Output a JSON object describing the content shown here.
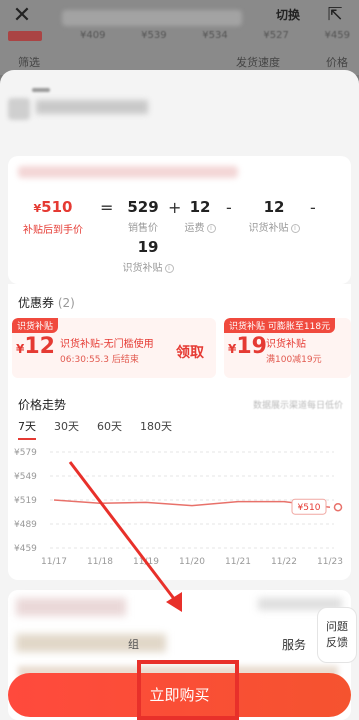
{
  "background": {
    "switch_label": "切换",
    "prices": [
      "¥409",
      "¥539",
      "¥534",
      "¥527",
      "¥459"
    ],
    "filter_label": "筛选",
    "filter2_label": "发货速度",
    "filter3_label": "价格"
  },
  "calc": {
    "final_price": "510",
    "final_price_label": "补贴后到手价",
    "eq": "=",
    "sales_price": "529",
    "sales_price_label": "销售价",
    "plus": "+",
    "shipping": "12",
    "shipping_label": "运费",
    "minus1": "-",
    "shipping_subsidy": "12",
    "shipping_subsidy_label": "识货补贴",
    "minus2": "-",
    "shihuo_subsidy": "19",
    "shihuo_subsidy_label": "识货补贴"
  },
  "coupons": {
    "title": "优惠券",
    "count": "(2)",
    "items": [
      {
        "tag": "识货补贴",
        "amount": "12",
        "desc": "识货补贴-无门槛使用",
        "countdown": "06:30:55.3",
        "countdown_suffix": "后结束",
        "claim": "领取"
      },
      {
        "tag": "识货补贴",
        "tag2": "可膨胀至118元",
        "amount": "19",
        "desc": "识货补贴",
        "desc2": "满100减19元"
      }
    ]
  },
  "price_trend": {
    "title": "价格走势",
    "note": "数据展示渠道每日低价",
    "tabs": [
      "7天",
      "30天",
      "60天",
      "180天"
    ],
    "active_tab": "7天",
    "badge": "¥510"
  },
  "chart_data": {
    "type": "line",
    "x": [
      "11/17",
      "11/18",
      "11/19",
      "11/20",
      "11/21",
      "11/22",
      "11/23"
    ],
    "series": [
      {
        "values": [
          519,
          515,
          516,
          512,
          517,
          517,
          510
        ]
      }
    ],
    "yticks": [
      "¥579",
      "¥549",
      "¥519",
      "¥489",
      "¥459"
    ],
    "ylim": [
      459,
      579
    ],
    "grid": true,
    "color": "#e8716a"
  },
  "footer": {
    "service_label": "服务",
    "tail_text": "组",
    "help_line1": "问题",
    "help_line2": "反馈",
    "buy_label": "立即购买"
  },
  "colors": {
    "accent": "#e53a33",
    "button": "#ff4a3d",
    "annotation": "#e8302a"
  }
}
